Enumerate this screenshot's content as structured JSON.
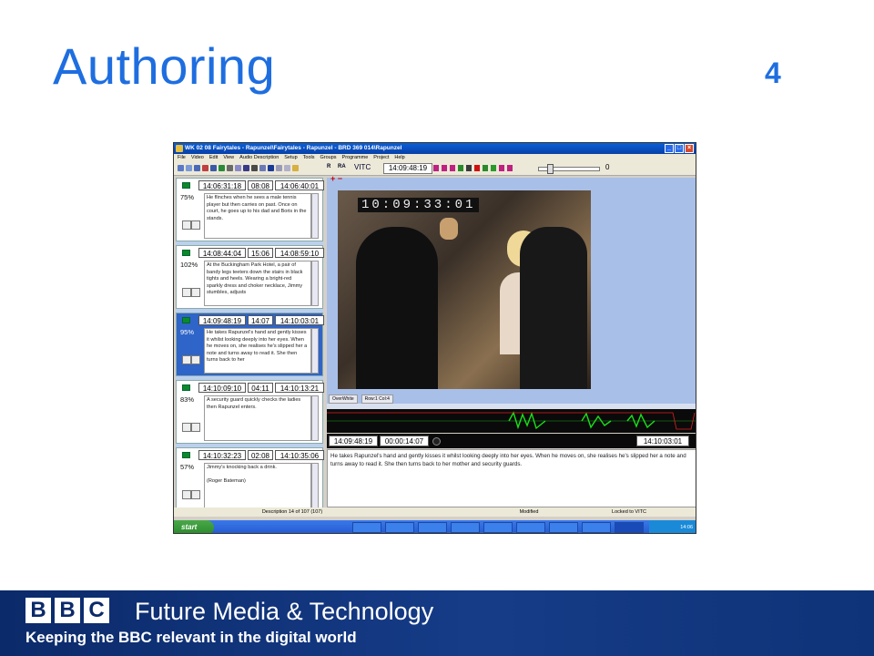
{
  "slide": {
    "title": "Authoring",
    "number": "4"
  },
  "window": {
    "title": "WK 02 08 Fairytales - Rapunzel\\Fairytales - Rapunzel - BRD 369 014\\Rapunzel",
    "menu": [
      "File",
      "Video",
      "Edit",
      "View",
      "Audio Description",
      "Setup",
      "Tools",
      "Groups",
      "Programme",
      "Project",
      "Help"
    ],
    "toolbar": {
      "r": "R",
      "ra": "RA",
      "vitc": "VITC",
      "timecode": "14:09:48:19",
      "zero": "0"
    }
  },
  "descriptions": [
    {
      "in": "14:06:31:18",
      "dur": "08:08",
      "out": "14:06:40:01",
      "pct": "75%",
      "text": "He flinches when he sees a male tennis player but then carries on past. Once on court, he goes up to his dad and Boris in the stands."
    },
    {
      "in": "14:08:44:04",
      "dur": "15:06",
      "out": "14:08:59:10",
      "pct": "102%",
      "text": "At the Buckingham Park Hotel, a pair of bandy legs teeters down the stairs in black tights and heels. Wearing a bright-red sparkly dress and choker necklace, Jimmy stumbles, adjusts"
    },
    {
      "in": "14:09:48:19",
      "dur": "14:07",
      "out": "14:10:03:01",
      "pct": "95%",
      "text": "He takes Rapunzel's hand and gently kisses it whilst looking deeply into her eyes. When he moves on, she realises he's slipped her a note and turns away to read it. She then turns back to her"
    },
    {
      "in": "14:10:09:10",
      "dur": "04:11",
      "out": "14:10:13:21",
      "pct": "83%",
      "text": "A security guard quickly checks the ladies then Rapunzel enters."
    },
    {
      "in": "14:10:32:23",
      "dur": "02:08",
      "out": "14:10:35:06",
      "pct": "57%",
      "text": "Jimmy's knocking back a drink.\n\n(Roger Bateman)"
    }
  ],
  "video": {
    "burn_in": "10:09:33:01",
    "status1": "OverWhite",
    "status2": "Row:1 Col:4"
  },
  "editor": {
    "in": "14:09:48:19",
    "dur": "00:00:14:07",
    "out": "14:10:03:01",
    "text": "He takes Rapunzel's hand and gently kisses it whilst looking deeply into her eyes. When he moves on, she realises he's slipped her a note and turns away to read it. She then turns back to her mother and security guards."
  },
  "statusbar": {
    "desc": "Description 14 of 107 (107)",
    "modified": "Modified",
    "locked": "Locked to VITC"
  },
  "taskbar": {
    "start": "start",
    "clock": "14:06"
  },
  "footer": {
    "bbc": [
      "B",
      "B",
      "C"
    ],
    "division": "Future Media & Technology",
    "tagline": "Keeping the BBC relevant in the digital world"
  },
  "colors": {
    "accent": "#1e6ee0",
    "footer": "#0b2a6a",
    "wave": "#18e018"
  }
}
